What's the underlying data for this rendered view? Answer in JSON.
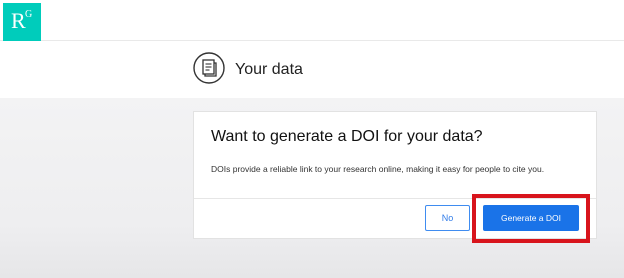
{
  "app": {
    "logo_text": "R",
    "logo_superscript": "G",
    "brand_color": "#00ccbb"
  },
  "header": {
    "icon": "document-icon",
    "title": "Your data"
  },
  "dialog": {
    "title": "Want to generate a DOI for your data?",
    "body": "DOIs provide a reliable link to your research online, making it easy for people to cite you.",
    "no_label": "No",
    "generate_label": "Generate a DOI",
    "primary_color": "#1a73e8"
  },
  "annotation": {
    "highlight_color": "#d8141c"
  }
}
